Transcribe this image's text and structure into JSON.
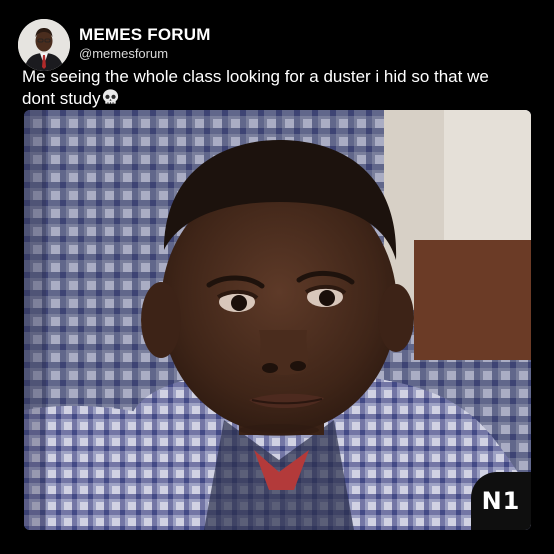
{
  "post": {
    "display_name": "MEMES FORUM",
    "handle": "@memesforum",
    "caption": "Me seeing the whole class looking for a duster i hid so that we dont study",
    "emoji_icon": "skull-icon"
  },
  "media": {
    "watermark": "N1"
  },
  "colors": {
    "background": "#000000",
    "text_primary": "#ffffff",
    "text_secondary": "#d8d8d8",
    "badge_bg": "#0f0f0f"
  }
}
